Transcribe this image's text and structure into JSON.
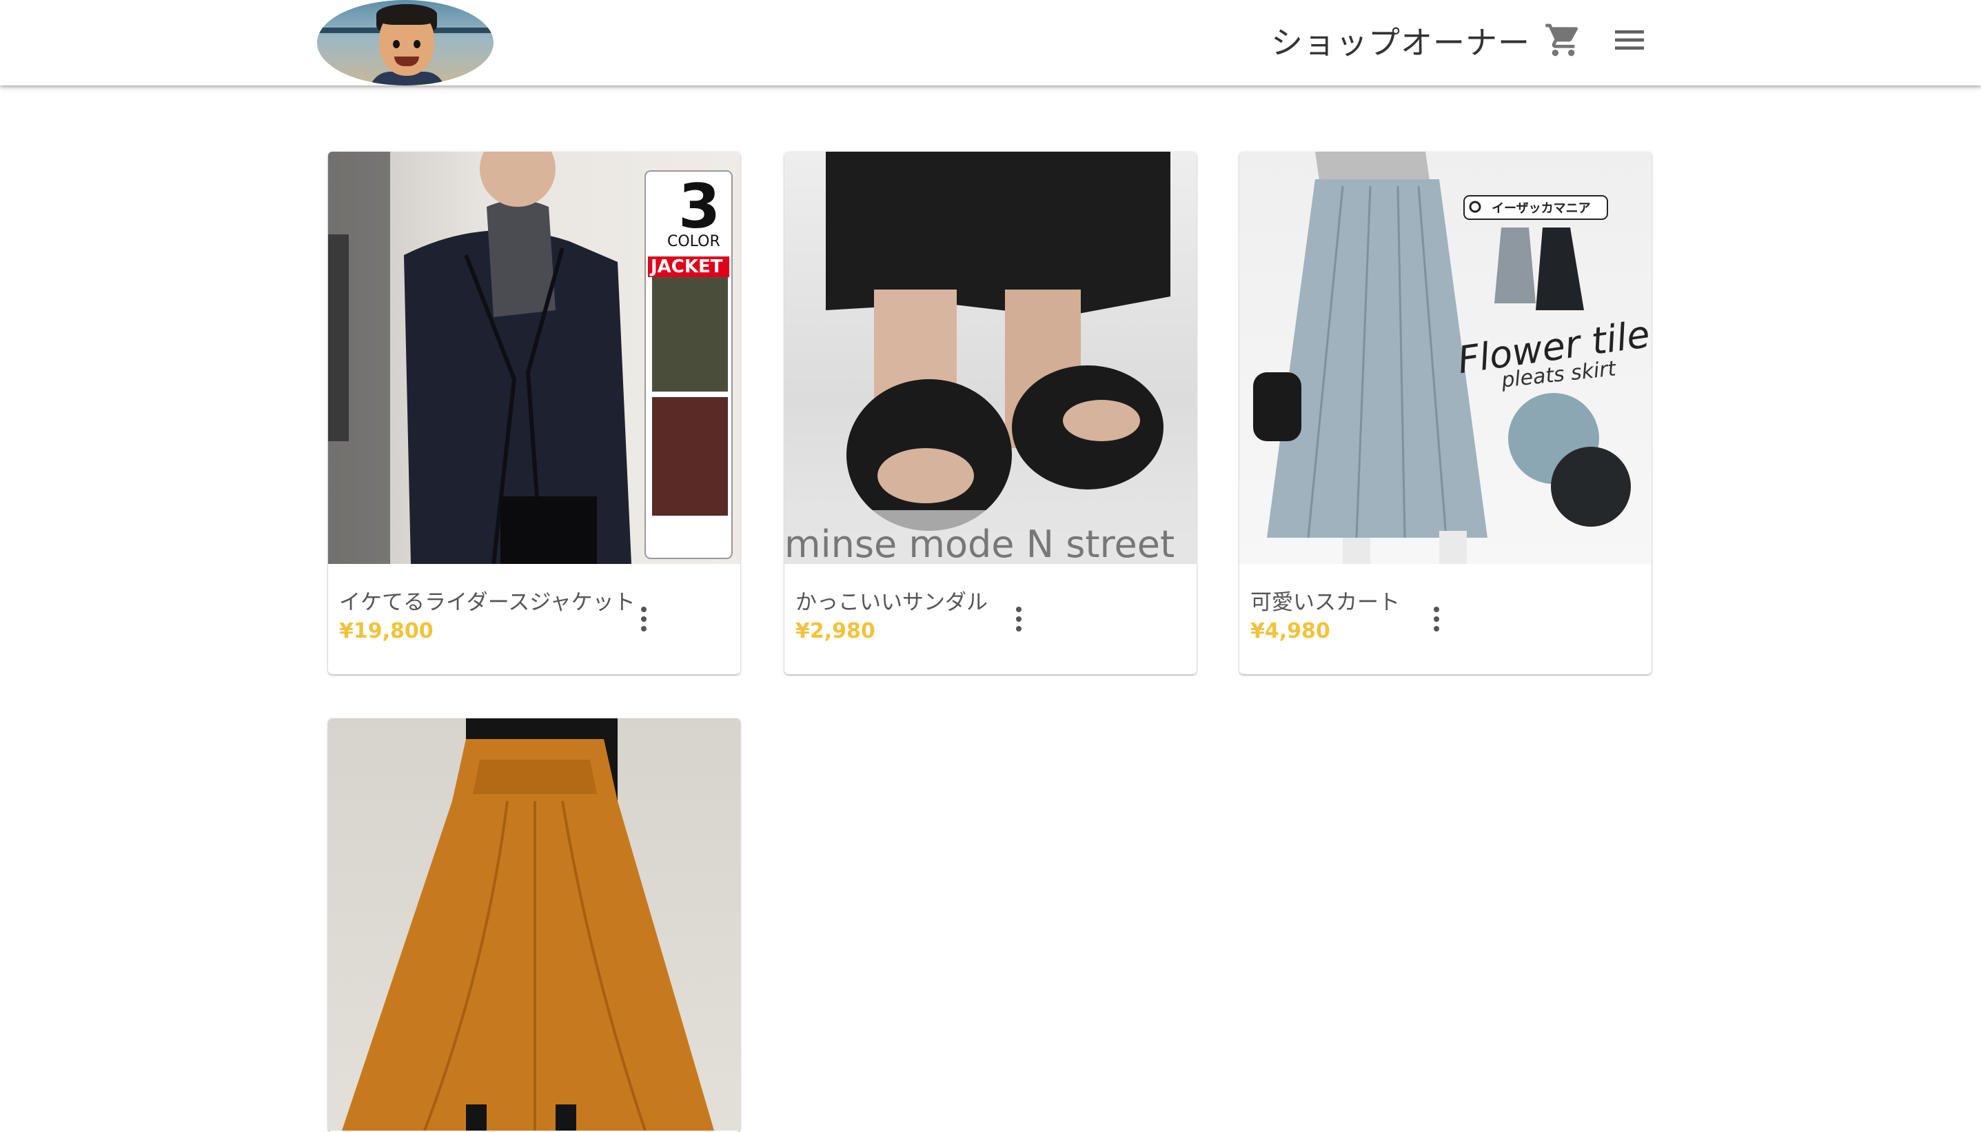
{
  "header": {
    "owner_title": "ショップオーナー",
    "cart_icon": "shopping-cart-icon",
    "menu_icon": "hamburger-menu-icon",
    "accent_color": "#f3c23c"
  },
  "products": [
    {
      "name": "イケてるライダースジャケット",
      "price": "¥19,800",
      "badge_number": "3",
      "badge_color": "COLOR",
      "badge_label": "JACKET"
    },
    {
      "name": "かっこいいサンダル",
      "price": "¥2,980",
      "watermark": "minse mode N street"
    },
    {
      "name": "可愛いスカート",
      "price": "¥4,980",
      "search_tag": "イーザッカマニア",
      "script_title": "Flower tile",
      "script_subtitle": "pleats skirt"
    },
    {
      "name": "",
      "price": ""
    }
  ]
}
